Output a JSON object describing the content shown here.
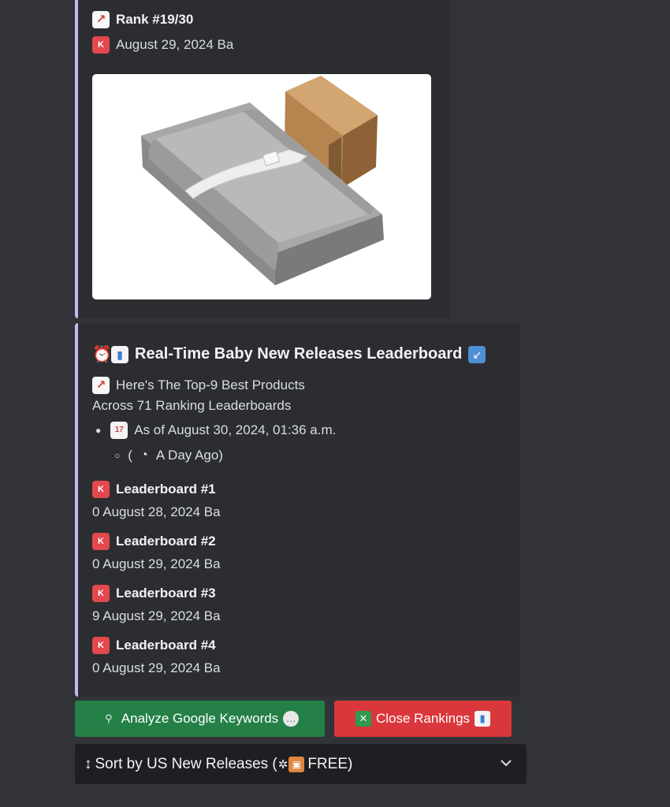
{
  "top_embed": {
    "rank_label": "Rank #19/30",
    "date_text": "August 29, 2024 Ba"
  },
  "leaderboard_embed": {
    "title": "Real-Time Baby New Releases Leaderboard",
    "intro_line1": "Here's The Top-9 Best Products",
    "intro_line2": "Across 71 Ranking Leaderboards",
    "as_of": "As of August 30, 2024, 01:36 a.m.",
    "relative_open": "(",
    "relative_time": "A Day Ago)",
    "leaderboards": [
      {
        "title": "Leaderboard #1",
        "detail": "0 August 28, 2024 Ba"
      },
      {
        "title": "Leaderboard #2",
        "detail": "0 August 29, 2024 Ba"
      },
      {
        "title": "Leaderboard #3",
        "detail": "9 August 29, 2024 Ba"
      },
      {
        "title": "Leaderboard #4",
        "detail": "0 August 29, 2024 Ba"
      }
    ]
  },
  "buttons": {
    "analyze_label": "Analyze Google Keywords",
    "close_label": "Close Rankings"
  },
  "sort_select": {
    "prefix": "↕",
    "label": "Sort by US New Releases (",
    "suffix": "FREE)"
  },
  "icons": {
    "stonks": "chart-increasing-icon",
    "post": "postbox-icon",
    "alarm": "alarm-clock-icon",
    "bar_chart": "bar-chart-icon",
    "arrow": "arrow-down-left-icon",
    "calendar": "calendar-icon",
    "clock": "clock-icon",
    "magnifier": "magnifier-icon",
    "speech": "speech-balloon-icon",
    "cross": "cross-mark-icon",
    "gear": "gear-icon",
    "gift": "gift-icon",
    "chevron": "chevron-down-icon"
  },
  "colors": {
    "embed_bar": "#c9b8f0",
    "analyze_button": "#248046",
    "close_button": "#da373c"
  }
}
